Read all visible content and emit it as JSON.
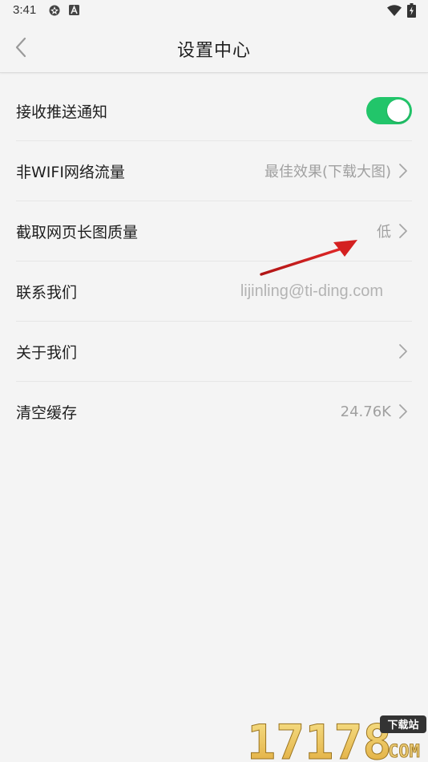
{
  "status_bar": {
    "time": "3:41",
    "icons": [
      "settings-gear-icon",
      "a-letter-icon",
      "wifi-icon",
      "battery-charging-icon"
    ]
  },
  "header": {
    "title": "设置中心",
    "back_icon": "chevron-left-icon"
  },
  "settings": {
    "items": [
      {
        "label": "接收推送通知",
        "control": "toggle",
        "enabled": true
      },
      {
        "label": "非WIFI网络流量",
        "value": "最佳效果(下载大图)",
        "chevron": true
      },
      {
        "label": "截取网页长图质量",
        "value": "低",
        "chevron": true
      },
      {
        "label": "联系我们",
        "value": "lijinling@ti-ding.com",
        "chevron": false
      },
      {
        "label": "关于我们",
        "value": "",
        "chevron": true
      },
      {
        "label": "清空缓存",
        "value": "24.76K",
        "chevron": true
      }
    ]
  },
  "annotation": {
    "type": "red-arrow",
    "color": "#d42020"
  },
  "watermark": {
    "number": "17178",
    "tag": "下载站",
    "suffix": "COM"
  },
  "colors": {
    "background": "#f4f4f4",
    "toggle_on": "#22c56a",
    "secondary_text": "#a0a0a0",
    "divider": "#e6e6e6"
  }
}
